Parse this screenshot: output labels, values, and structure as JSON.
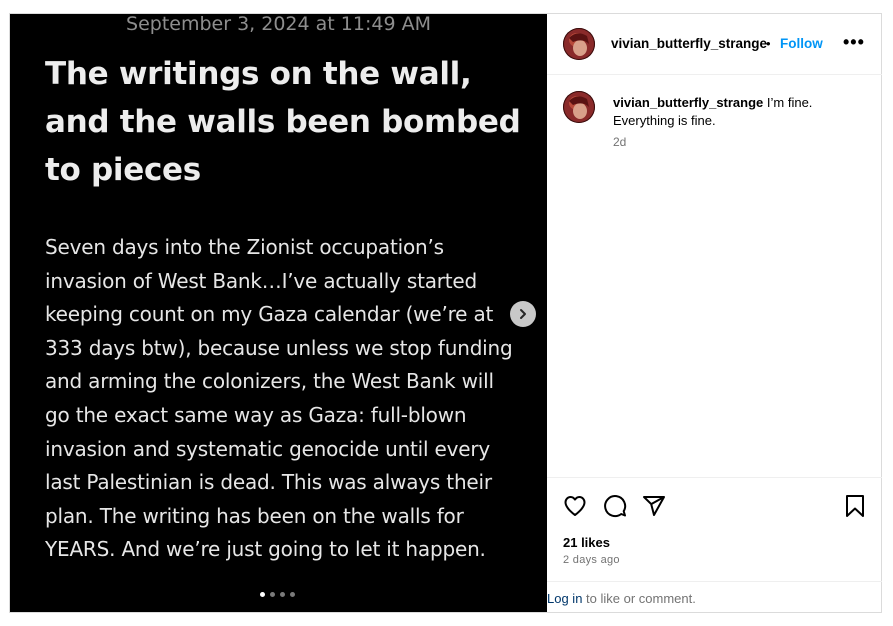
{
  "media": {
    "date": "September 3, 2024 at 11:49 AM",
    "title": "The writings on the wall, and the walls been bombed to pieces",
    "body": "Seven days into the Zionist occupation’s invasion of West Bank…I’ve actually started keeping count on my Gaza calendar (we’re at 333 days btw), because unless we stop funding and arming the colonizers, the West Bank will go the exact same way as Gaza: full-blown invasion and systematic genocide until every last Palestinian is dead. This was always their plan. The writing has been on the walls for YEARS. And we’re just going to let it happen.",
    "next_icon": "chevron-right-icon",
    "carousel_dots": 4,
    "carousel_active_index": 0
  },
  "header": {
    "username": "vivian_butterfly_strange",
    "separator": "•",
    "follow_label": "Follow",
    "more_label": "•••"
  },
  "caption": {
    "username": "vivian_butterfly_strange",
    "text": "I’m fine. Everything is fine.",
    "time": "2d"
  },
  "actions": {
    "icons": [
      "heart-icon",
      "comment-icon",
      "share-icon",
      "bookmark-icon"
    ],
    "likes": "21 likes",
    "time": "2 days ago"
  },
  "login": {
    "link_label": "Log in",
    "suffix": " to like or comment."
  },
  "colors": {
    "accent": "#0095f6",
    "media_bg": "#000000",
    "muted_text": "#737373"
  }
}
